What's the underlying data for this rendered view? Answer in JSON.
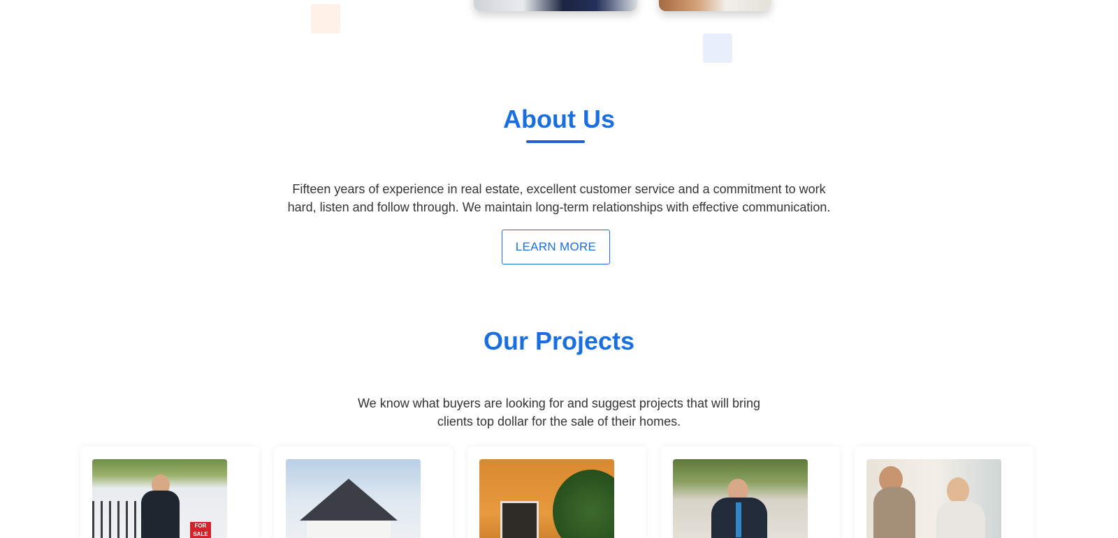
{
  "about": {
    "title": "About Us",
    "text_line1": "Fifteen years of experience in real estate, excellent customer service and a commitment to work",
    "text_line2": "hard, listen and follow through. We maintain long-term relationships with effective communication.",
    "button_label": "LEARN MORE"
  },
  "projects": {
    "title": "Our Projects",
    "text_line1": "We know what buyers are looking for and suggest projects that will bring",
    "text_line2": "clients top dollar for the sale of their homes.",
    "cards": [
      {
        "image": "agent-for-sale-photo",
        "sign_text": "FOR SALE"
      },
      {
        "image": "house-roof-photo"
      },
      {
        "image": "orange-house-photo"
      },
      {
        "image": "celebrating-agent-photo"
      },
      {
        "image": "meeting-photo"
      }
    ]
  },
  "colors": {
    "accent": "#1a6fe0",
    "underline": "#1d5fd6",
    "text": "#333333",
    "deco_peach": "#fff0e8",
    "deco_blue": "#e8eefc"
  }
}
